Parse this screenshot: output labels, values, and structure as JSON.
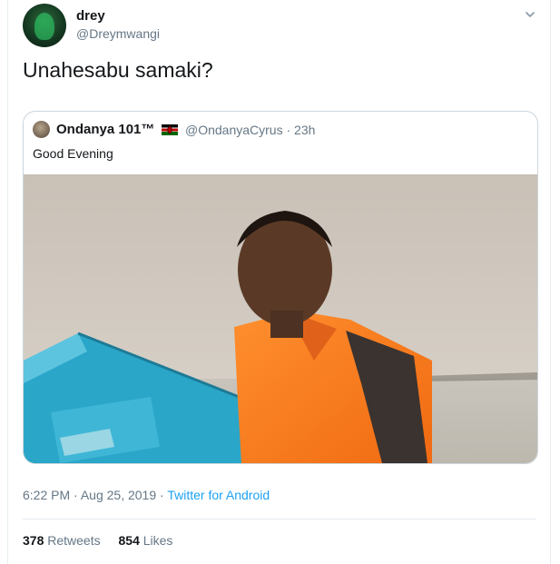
{
  "tweet": {
    "author_name": "drey",
    "author_handle": "@Dreymwangi",
    "text": "Unahesabu samaki?",
    "time": "6:22 PM",
    "date": "Aug 25, 2019",
    "separator": "·",
    "source": "Twitter for Android",
    "retweets_count": "378",
    "retweets_label": "Retweets",
    "likes_count": "854",
    "likes_label": "Likes"
  },
  "quoted": {
    "author_name": "Ondanya 101™",
    "author_handle": "@OndanyaCyrus",
    "age": "23h",
    "text": "Good Evening"
  },
  "icons": {
    "caret": "chevron-down-icon",
    "flag": "kenya-flag-icon"
  },
  "colors": {
    "link": "#1da1f2",
    "secondary_text": "#657786",
    "border": "#ccd6dd"
  }
}
